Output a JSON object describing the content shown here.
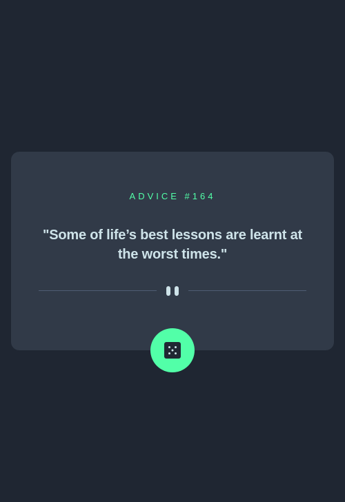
{
  "advice": {
    "label": "ADVICE #164",
    "quote": "\"Some of life’s best lessons are learnt at the worst times.\""
  },
  "divider": {
    "icon": "pause-icon"
  },
  "dice_button": {
    "icon": "dice-icon"
  },
  "colors": {
    "background": "#1f2632",
    "card": "#313a48",
    "accent": "#52ffa8",
    "text": "#cee3e9",
    "divider": "#4f5d74"
  }
}
